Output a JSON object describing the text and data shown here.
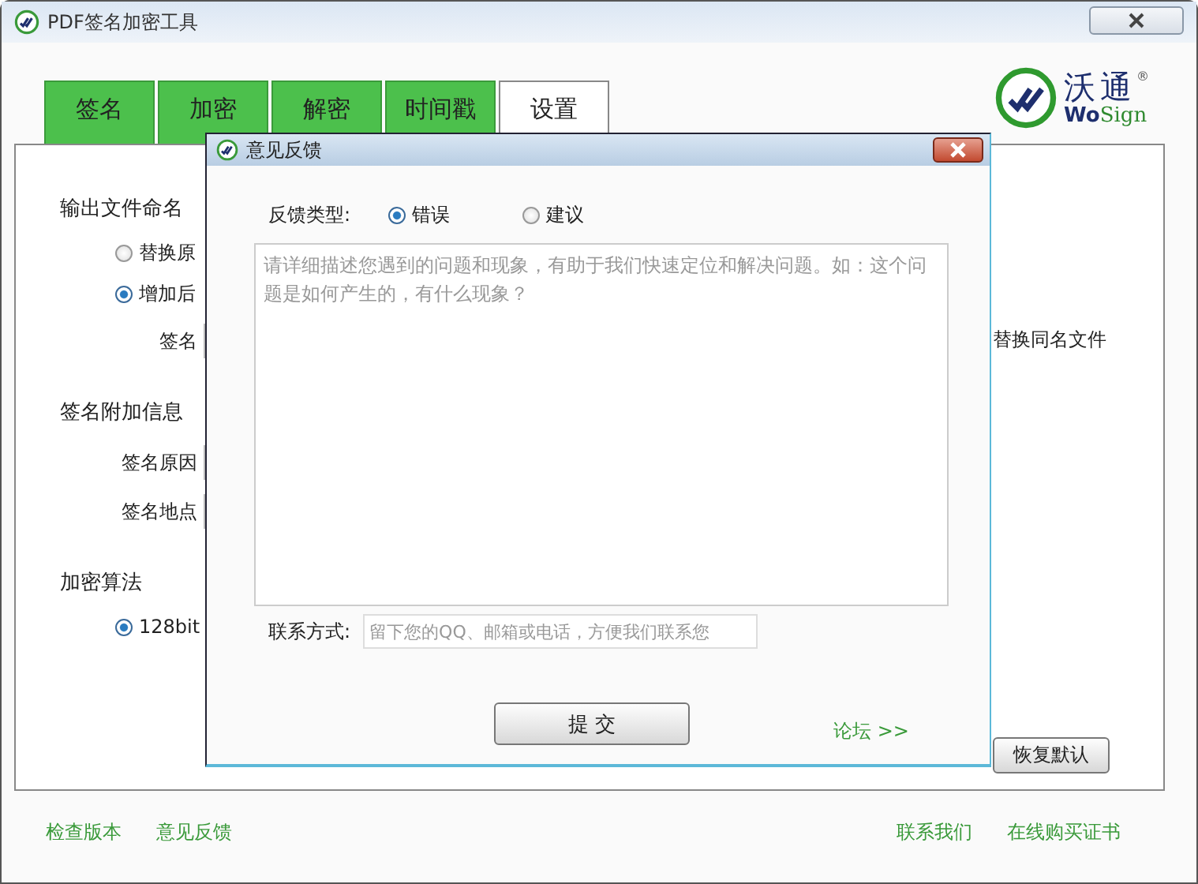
{
  "window": {
    "title": "PDF签名加密工具"
  },
  "logo": {
    "name": "沃通",
    "mark": "®",
    "sub_bold": "Wo",
    "sub": "Sign"
  },
  "tabs": [
    {
      "label": "签名",
      "selected": false
    },
    {
      "label": "加密",
      "selected": false
    },
    {
      "label": "解密",
      "selected": false
    },
    {
      "label": "时间戳",
      "selected": false
    },
    {
      "label": "设置",
      "selected": true
    }
  ],
  "settings": {
    "sections": [
      {
        "title": "输出文件命名",
        "items": [
          {
            "kind": "radio",
            "label": "替换原",
            "selected": false
          },
          {
            "kind": "radio",
            "label": "增加后",
            "selected": true
          },
          {
            "kind": "field",
            "label": "签名"
          }
        ]
      },
      {
        "title": "签名附加信息",
        "items": [
          {
            "kind": "field",
            "label": "签名原因"
          },
          {
            "kind": "field",
            "label": "签名地点"
          }
        ]
      },
      {
        "title": "加密算法",
        "items": [
          {
            "kind": "radio",
            "label": "128bit",
            "selected": true
          }
        ]
      }
    ],
    "replace_label": "替换同名文件",
    "reset_button": "恢复默认"
  },
  "footer": {
    "left_links": [
      "检查版本",
      "意见反馈"
    ],
    "right_links": [
      "联系我们",
      "在线购买证书"
    ]
  },
  "dialog": {
    "title": "意见反馈",
    "type_label": "反馈类型:",
    "types": [
      {
        "label": "错误",
        "selected": true
      },
      {
        "label": "建议",
        "selected": false
      }
    ],
    "description_placeholder": "请详细描述您遇到的问题和现象，有助于我们快速定位和解决问题。如：这个问题是如何产生的，有什么现象？",
    "contact_label": "联系方式:",
    "contact_placeholder": "留下您的QQ、邮箱或电话，方便我们联系您",
    "submit_button": "提 交",
    "forum_link": "论坛 >>"
  }
}
